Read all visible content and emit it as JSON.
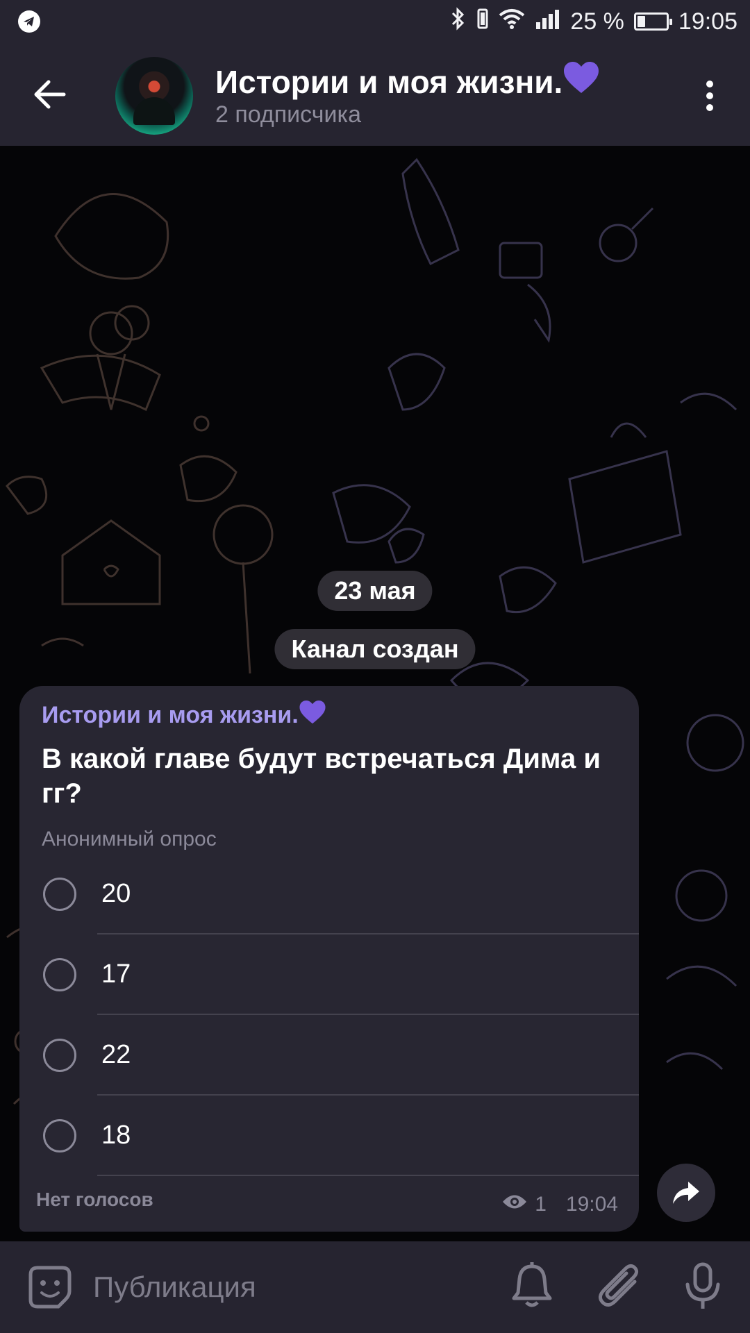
{
  "status_bar": {
    "battery_text": "25 %",
    "battery_level": 0.25,
    "time": "19:05"
  },
  "header": {
    "title": "Истории и моя жизни.",
    "title_emoji": "💜",
    "subtitle": "2 подписчика"
  },
  "chat": {
    "date_label": "23 мая",
    "service_message": "Канал создан",
    "message": {
      "author": "Истории и моя жизни.",
      "author_emoji": "💜",
      "question": "В какой главе будут встречаться Дима и гг?",
      "poll_type": "Анонимный опрос",
      "options": [
        "20",
        "17",
        "22",
        "18"
      ],
      "no_votes": "Нет голосов",
      "views": "1",
      "time": "19:04"
    }
  },
  "composer": {
    "placeholder": "Публикация"
  },
  "colors": {
    "bar_bg": "#262430",
    "bubble_bg": "#282632",
    "accent_author": "#a89cf0",
    "heart_purple": "#7b5be0"
  },
  "icons": {
    "status_left": "telegram-icon",
    "status_right": [
      "bluetooth-icon",
      "vibrate-icon",
      "wifi-icon",
      "signal-icon",
      "battery-icon"
    ],
    "header": [
      "back-arrow-icon",
      "more-vert-icon"
    ],
    "message": [
      "eye-icon",
      "share-icon"
    ],
    "composer": [
      "sticker-icon",
      "bell-icon",
      "paperclip-icon",
      "mic-icon"
    ]
  }
}
